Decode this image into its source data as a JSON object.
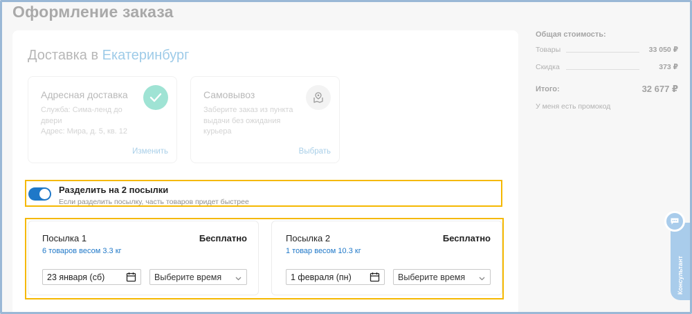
{
  "page": {
    "title": "Оформление заказа"
  },
  "delivery": {
    "heading_prefix": "Доставка в",
    "city": "Екатеринбург",
    "options": [
      {
        "title": "Адресная доставка",
        "desc_line1": "Служба: Сима-ленд до двери",
        "desc_line2": "Адрес: Мира, д. 5, кв. 12",
        "link": "Изменить",
        "selected": true,
        "icon": "check-icon"
      },
      {
        "title": "Самовывоз",
        "desc_line1": "Заберите заказ из пункта выдачи без ожидания курьера",
        "link": "Выбрать",
        "selected": false,
        "icon": "map-pin-icon"
      }
    ]
  },
  "split": {
    "enabled": true,
    "title": "Разделить на 2 посылки",
    "subtitle": "Если разделить посылку, часть товаров придет быстрее"
  },
  "parcels": [
    {
      "title": "Посылка 1",
      "price": "Бесплатно",
      "weight": "6 товаров весом 3.3 кг",
      "date": "23 января (сб)",
      "time_placeholder": "Выберите время"
    },
    {
      "title": "Посылка 2",
      "price": "Бесплатно",
      "weight": "1 товар весом 10.3 кг",
      "date": "1 февраля (пн)",
      "time_placeholder": "Выберите время"
    }
  ],
  "summary": {
    "title": "Общая стоимость:",
    "goods_label": "Товары",
    "goods_value": "33 050 ₽",
    "discount_label": "Скидка",
    "discount_value": "373 ₽",
    "total_label": "Итого:",
    "total_value": "32 677 ₽",
    "promo": "У меня есть промокод"
  },
  "consultant": {
    "label": "Консультант"
  },
  "colors": {
    "accent": "#1f78c8",
    "highlight": "#f5b800",
    "check": "#9fe3d4"
  }
}
